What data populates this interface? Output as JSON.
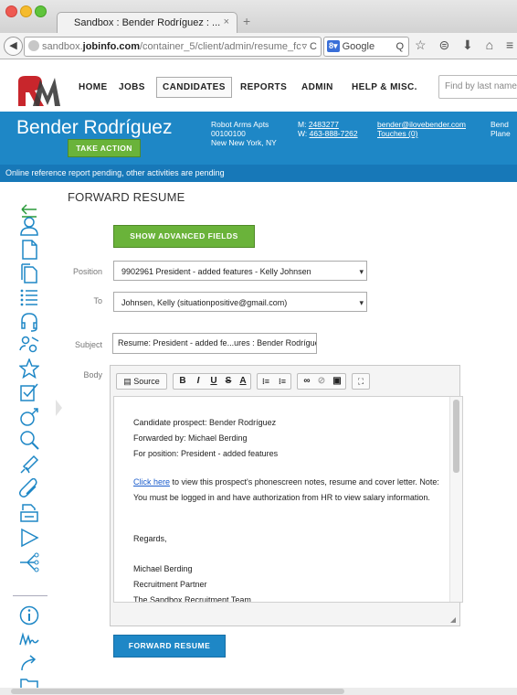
{
  "browser": {
    "tab_title": "Sandbox : Bender Rodríguez : ...",
    "tab_close": "×",
    "new_tab": "+",
    "url_domain_prefix": "sandbox.",
    "url_domain": "jobinfo.com",
    "url_path": "/container_5/client/admin/resume_fc",
    "url_suffix": "▿ C",
    "search_engine": "Google",
    "search_icon_glyph": "Q",
    "toolbar_icons": "☆ ⊜ ⬇ ⌂ ≡"
  },
  "app": {
    "logo_text": "RM",
    "menu": [
      "HOME",
      "JOBS",
      "CANDIDATES",
      "REPORTS",
      "ADMIN",
      "HELP & MISC."
    ],
    "active_menu": "CANDIDATES",
    "find_placeholder": "Find by last name..."
  },
  "candidate": {
    "name": "Bender Rodríguez",
    "take_action": "TAKE ACTION",
    "address_line1": "Robot Arms Apts",
    "address_line2": "00100100",
    "address_line3": "New New York, NY",
    "mobile_label": "M:",
    "mobile": "2483277",
    "work_label": "W:",
    "work": "463-888-7262",
    "email": "bender@ilovebender.com",
    "touches": "Touches (0)",
    "extra1": "Bend",
    "extra2": "Plane"
  },
  "status_message": "Online reference report pending, other activities are pending",
  "form": {
    "heading": "FORWARD RESUME",
    "advanced_button": "SHOW ADVANCED FIELDS",
    "position_label": "Position",
    "position_value": "9902961 President - added features - Kelly Johnsen",
    "to_label": "To",
    "to_value": "Johnsen, Kelly (situationpositive@gmail.com)",
    "subject_label": "Subject",
    "subject_value": "Resume: President - added fe...ures : Bender Rodríguez",
    "body_label": "Body",
    "submit_button": "FORWARD RESUME"
  },
  "editor": {
    "source_label": "Source",
    "bold": "B",
    "italic": "I",
    "underline": "U",
    "strike": "S",
    "font_color": "A",
    "ordered_list": "⁝≡",
    "bullet_list": "⁝≡",
    "link": "∞",
    "unlink": "⊘",
    "image": "▣",
    "maximize": "⛶",
    "lines": {
      "l1": "Candidate prospect: Bender Rodríguez",
      "l2": "Forwarded by: Michael Berding",
      "l3": "For position: President - added features",
      "link_text": "Click here",
      "l4_rest": " to view this prospect's phonescreen notes, resume and cover letter. Note: You must be logged in and have authorization from HR to view salary information.",
      "l5": "Regards,",
      "l6": "Michael Berding",
      "l7": "Recruitment Partner",
      "l8": "The Sandbox Recruitment Team"
    }
  },
  "colors": {
    "brand_blue": "#1e87c6",
    "action_green": "#6ab33a",
    "logo_red": "#c8262c"
  }
}
